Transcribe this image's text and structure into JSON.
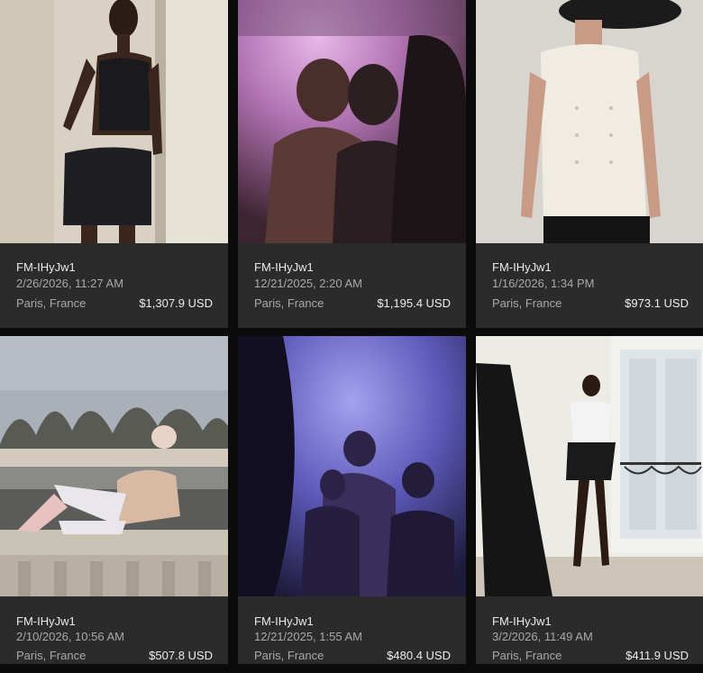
{
  "listings": [
    {
      "code": "FM-IHyJw1",
      "datetime": "2/26/2026, 11:27 AM",
      "location": "Paris, France",
      "price": "$1,307.9 USD"
    },
    {
      "code": "FM-IHyJw1",
      "datetime": "12/21/2025, 2:20 AM",
      "location": "Paris, France",
      "price": "$1,195.4 USD"
    },
    {
      "code": "FM-IHyJw1",
      "datetime": "1/16/2026, 1:34 PM",
      "location": "Paris, France",
      "price": "$973.1 USD"
    },
    {
      "code": "FM-IHyJw1",
      "datetime": "2/10/2026, 10:56 AM",
      "location": "Paris, France",
      "price": "$507.8 USD"
    },
    {
      "code": "FM-IHyJw1",
      "datetime": "12/21/2025, 1:55 AM",
      "location": "Paris, France",
      "price": "$480.4 USD"
    },
    {
      "code": "FM-IHyJw1",
      "datetime": "3/2/2026, 11:49 AM",
      "location": "Paris, France",
      "price": "$411.9 USD"
    }
  ]
}
